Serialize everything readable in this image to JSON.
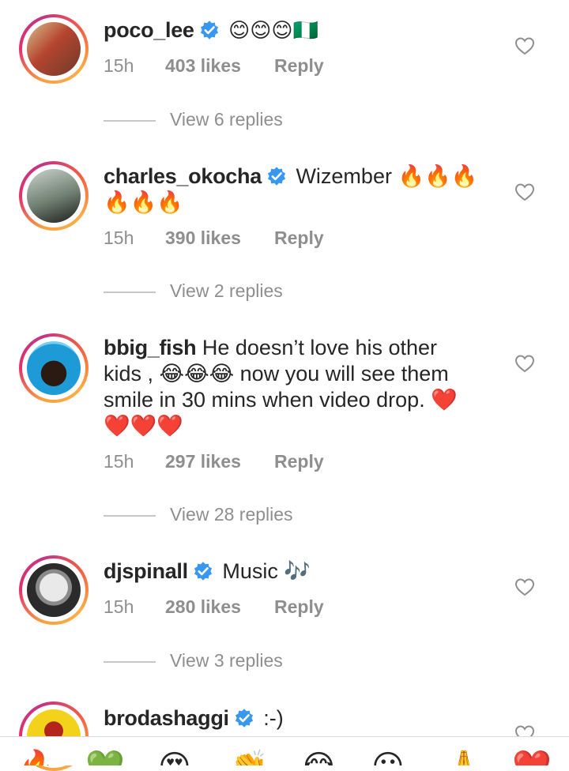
{
  "comments": [
    {
      "username": "poco_lee",
      "verified": true,
      "text": "😊😊😊🇳🇬",
      "time": "15h",
      "likes": "403 likes",
      "reply": "Reply",
      "view_replies": "View 6 replies",
      "avatar_colors": [
        "#b5452f",
        "#d7c08e",
        "#6d3a2a"
      ]
    },
    {
      "username": "charles_okocha",
      "verified": true,
      "text_line1": "Wizember 🔥🔥🔥",
      "text_line2": "🔥🔥🔥",
      "time": "15h",
      "likes": "390 likes",
      "reply": "Reply",
      "view_replies": "View 2 replies",
      "avatar_colors": [
        "#6f7f70",
        "#1c1c1c",
        "#c9d3cf"
      ]
    },
    {
      "username": "bbig_fish",
      "verified": false,
      "text_line1": "He doesn’t love his other",
      "text_line2": "kids , 😂😂😂 now you will see them",
      "text_line3": "smile in 30 mins when video drop. ❤️",
      "text_line4": "❤️❤️❤️",
      "time": "15h",
      "likes": "297 likes",
      "reply": "Reply",
      "view_replies": "View 28 replies",
      "avatar_colors": [
        "#1e9bd7",
        "#2b1a12",
        "#74d0f0"
      ]
    },
    {
      "username": "djspinall",
      "verified": true,
      "text": "Music 🎶",
      "time": "15h",
      "likes": "280 likes",
      "reply": "Reply",
      "view_replies": "View 3 replies",
      "avatar_colors": [
        "#e9e9e9",
        "#2b2b2b",
        "#c44"
      ]
    },
    {
      "username": "brodashaggi",
      "verified": true,
      "text": ":-)",
      "avatar_colors": [
        "#f2d21b",
        "#b3241d",
        "#3a2a1a"
      ]
    }
  ],
  "emoji_bar": [
    "🔥",
    "💚",
    "😍",
    "👏",
    "😂",
    "😮",
    "🙏",
    "❤️"
  ],
  "colors": {
    "verified_blue": "#3897f0",
    "muted": "#8e8e8e",
    "text": "#262626"
  }
}
